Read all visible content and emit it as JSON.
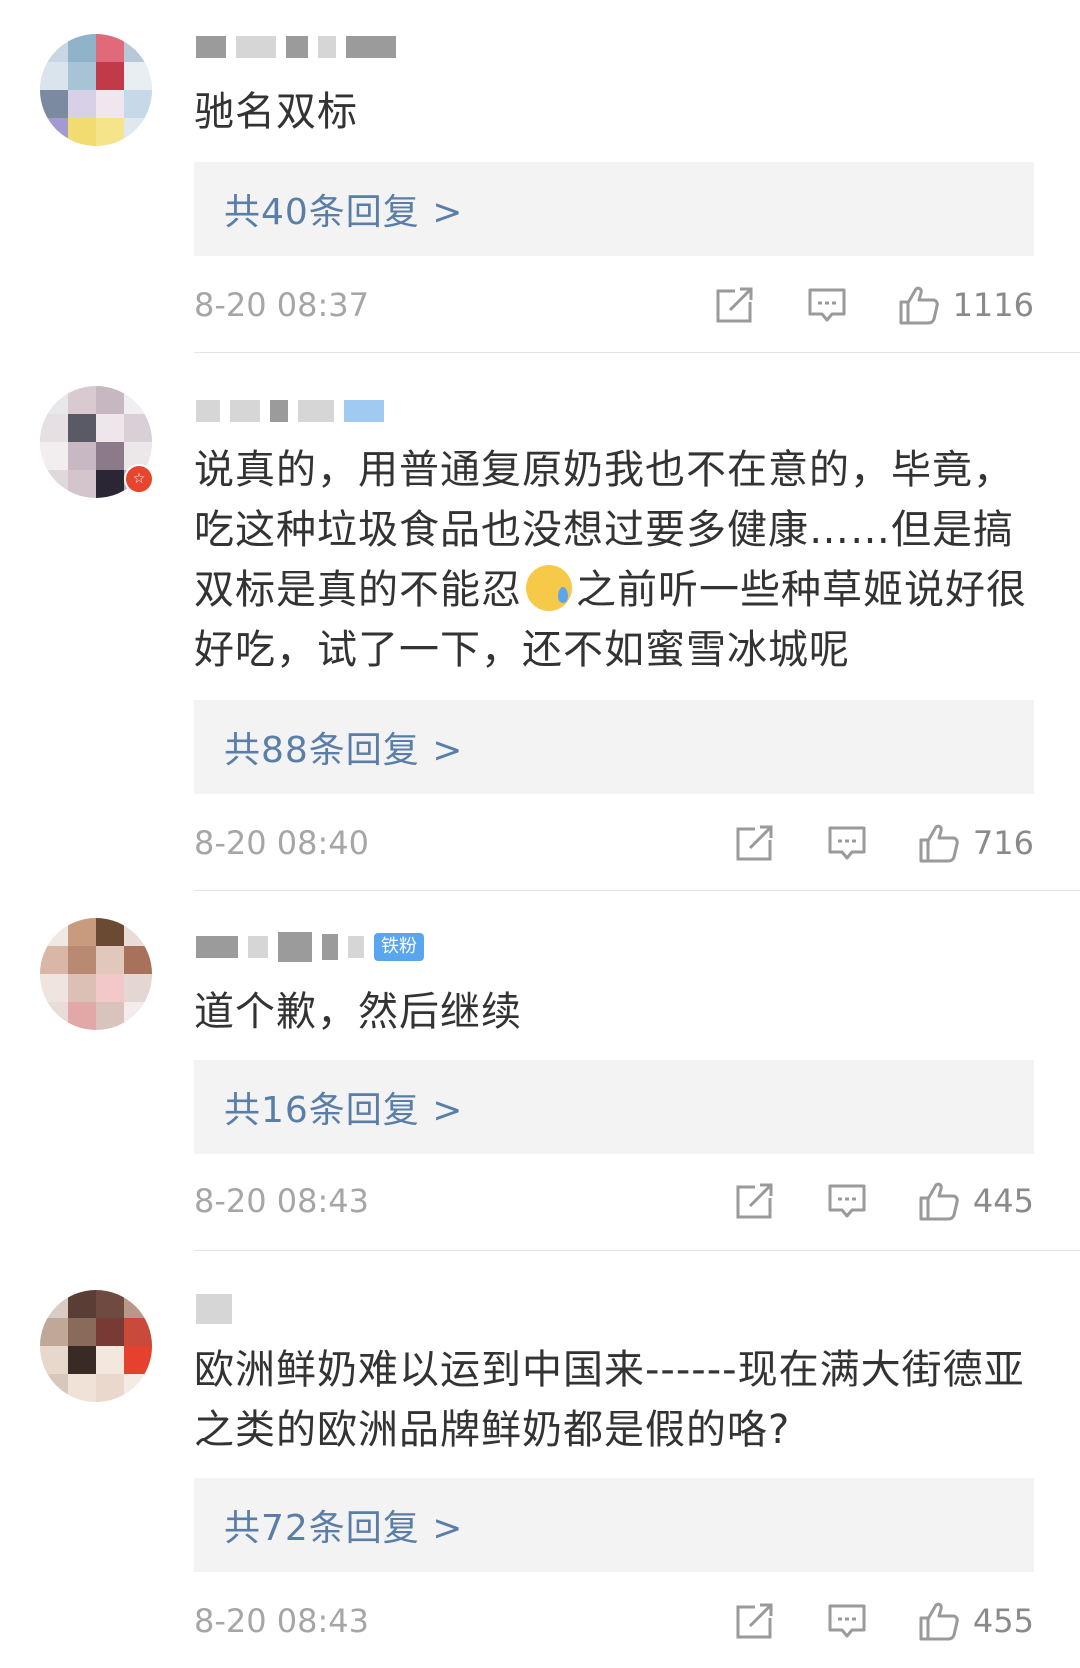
{
  "comments": [
    {
      "text": "驰名双标",
      "replies": "共40条回复 >",
      "time": "8-20 08:37",
      "likes": "1116",
      "fan_badge": ""
    },
    {
      "text_parts": [
        "说真的，用普通复原奶我也不在意的，毕竟，吃这种垃圾食品也没想过要多健康……但是搞双标是真的不能忍",
        "之前听一些种草姬说好很好吃，试了一下，还不如蜜雪冰城呢"
      ],
      "emoji": "sweat-face-emoji",
      "replies": "共88条回复 >",
      "time": "8-20 08:40",
      "likes": "716"
    },
    {
      "text": "道个歉，然后继续",
      "fan_badge": "铁粉",
      "replies": "共16条回复 >",
      "time": "8-20 08:43",
      "likes": "445"
    },
    {
      "text": "欧洲鲜奶难以运到中国来------现在满大街德亚之类的欧洲品牌鲜奶都是假的咯?",
      "replies": "共72条回复 >",
      "time": "8-20 08:43",
      "likes": "455"
    }
  ],
  "icons": {
    "share": "share-icon",
    "comment": "comment-icon",
    "like": "thumbs-up-icon"
  },
  "colors": {
    "reply_link": "#5a7ea8",
    "reply_bg": "#f3f3f3",
    "meta_text": "#a6a6a6",
    "fan_badge": "#5aa6ee"
  }
}
